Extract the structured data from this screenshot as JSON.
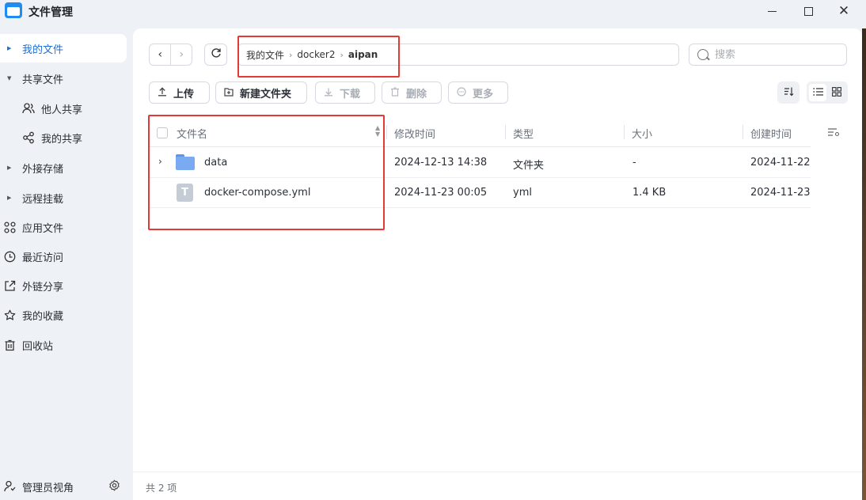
{
  "app": {
    "title": "文件管理"
  },
  "window_controls": {
    "minimize": "—",
    "maximize": "☐",
    "close": "✕"
  },
  "sidebar": {
    "items": [
      {
        "label": "我的文件",
        "icon": "caret-right-icon"
      },
      {
        "label": "共享文件",
        "icon": "caret-down-icon"
      },
      {
        "label": "他人共享",
        "icon": "users-icon"
      },
      {
        "label": "我的共享",
        "icon": "share-icon"
      },
      {
        "label": "外接存储",
        "icon": "caret-right-icon"
      },
      {
        "label": "远程挂载",
        "icon": "caret-right-icon"
      },
      {
        "label": "应用文件",
        "icon": "apps-icon"
      },
      {
        "label": "最近访问",
        "icon": "clock-icon"
      },
      {
        "label": "外链分享",
        "icon": "external-link-icon"
      },
      {
        "label": "我的收藏",
        "icon": "star-icon"
      },
      {
        "label": "回收站",
        "icon": "trash-icon"
      }
    ],
    "footer": {
      "label": "管理员视角"
    }
  },
  "path": {
    "crumbs": [
      "我的文件",
      "docker2",
      "aipan"
    ]
  },
  "search": {
    "placeholder": "搜索"
  },
  "toolbar": {
    "upload": "上传",
    "new_folder": "新建文件夹",
    "download": "下载",
    "delete": "删除",
    "more": "更多"
  },
  "table": {
    "columns": [
      "文件名",
      "修改时间",
      "类型",
      "大小",
      "创建时间"
    ],
    "rows": [
      {
        "name": "data",
        "modified": "2024-12-13 14:38",
        "type": "文件夹",
        "size": "-",
        "created": "2024-11-22"
      },
      {
        "name": "docker-compose.yml",
        "modified": "2024-11-23 00:05",
        "type": "yml",
        "size": "1.4 KB",
        "created": "2024-11-23"
      }
    ]
  },
  "status": {
    "text": "共 2 项"
  },
  "colors": {
    "accent": "#1f6fd1",
    "annotation": "#e53935",
    "folder": "#7aaaf2"
  }
}
